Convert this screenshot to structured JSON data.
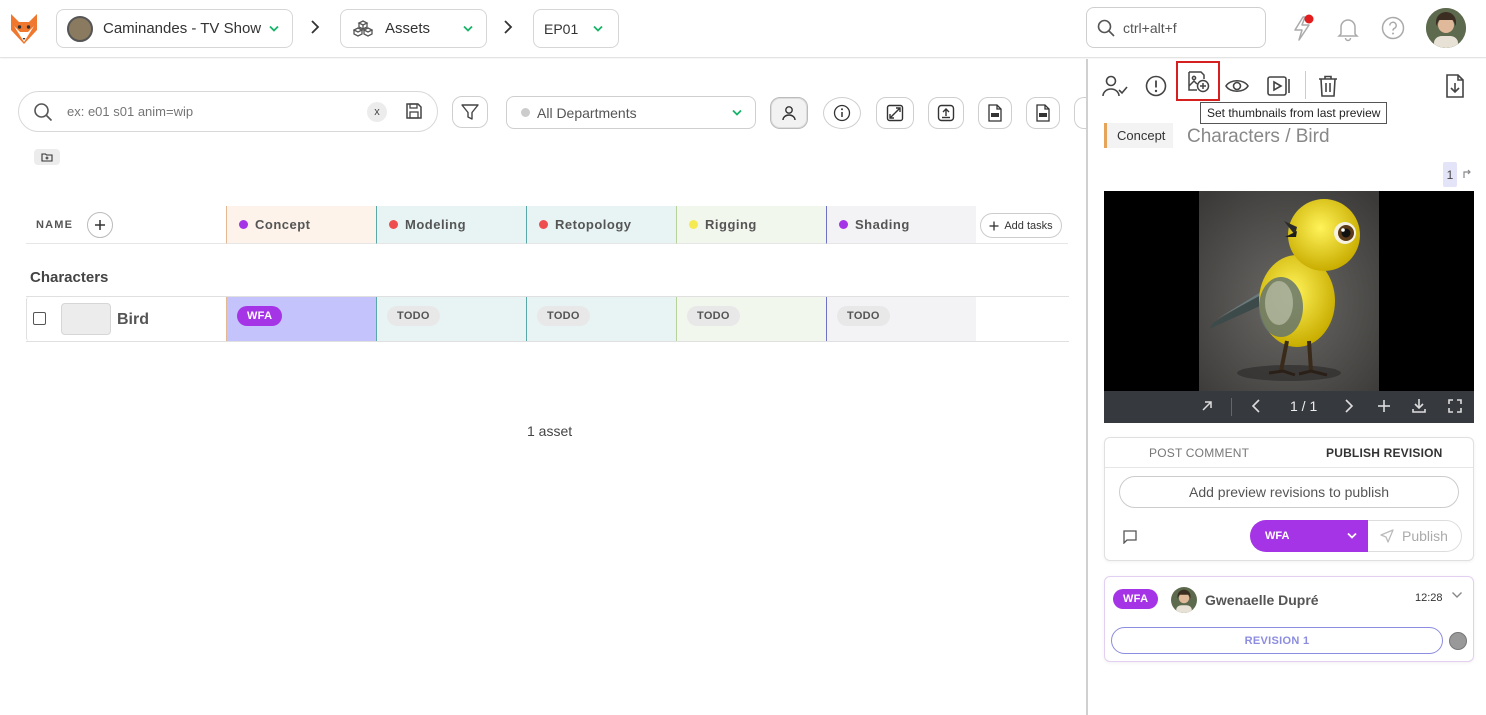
{
  "topbar": {
    "production": "Caminandes - TV Show",
    "section": "Assets",
    "episode": "EP01",
    "search_placeholder": "ctrl+alt+f"
  },
  "filters": {
    "search_placeholder": "ex: e01 s01 anim=wip",
    "clear_label": "x",
    "department": "All Departments"
  },
  "table": {
    "name_header": "NAME",
    "columns": [
      {
        "label": "Concept",
        "color": "#a534e6",
        "bg": "#fdf3ea",
        "border": "#e5b894"
      },
      {
        "label": "Modeling",
        "color": "#ef4e4e",
        "bg": "#e8f4f4",
        "border": "#5aa8a8"
      },
      {
        "label": "Retopology",
        "color": "#ef4e4e",
        "bg": "#e8f4f4",
        "border": "#5aa8a8"
      },
      {
        "label": "Rigging",
        "color": "#f5ea52",
        "bg": "#f2f7ee",
        "border": "#b7d29b"
      },
      {
        "label": "Shading",
        "color": "#a534e6",
        "bg": "#f3f3f5",
        "border": "#6f73c8"
      }
    ],
    "add_tasks": "Add tasks",
    "group": "Characters",
    "rows": [
      {
        "name": "Bird",
        "statuses": [
          "WFA",
          "TODO",
          "TODO",
          "TODO",
          "TODO"
        ]
      }
    ],
    "footer": "1 asset"
  },
  "panel": {
    "tooltip": "Set thumbnails from last preview",
    "task_type": "Concept",
    "entity_title": "Characters / Bird",
    "revision_badge": "1",
    "player_counter": "1 / 1",
    "tabs": [
      "POST COMMENT",
      "PUBLISH REVISION"
    ],
    "add_preview_label": "Add preview revisions to publish",
    "status_select": "WFA",
    "publish_label": "Publish",
    "comment": {
      "status": "WFA",
      "author": "Gwenaelle Dupré",
      "time": "12:28",
      "revision": "REVISION 1"
    }
  },
  "colors": {
    "accent_green": "#17b26a",
    "wfa": "#a534e6",
    "notif_red": "#e11d1d",
    "highlight_red": "#d61f1f"
  }
}
